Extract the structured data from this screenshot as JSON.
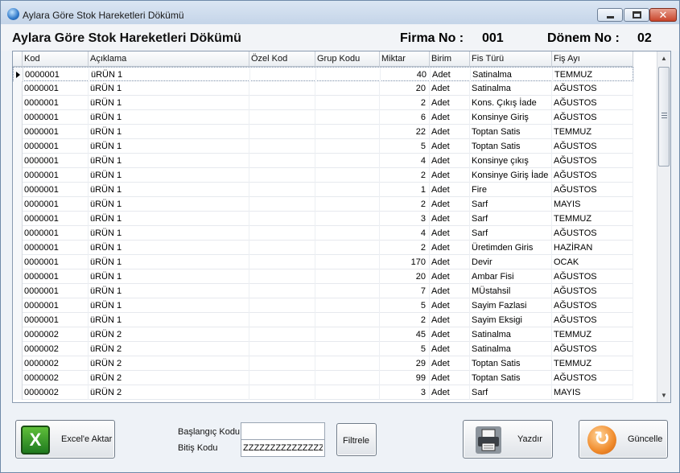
{
  "window": {
    "title": "Aylara Göre Stok Hareketleri Dökümü"
  },
  "header": {
    "title": "Aylara Göre Stok Hareketleri Dökümü",
    "firma_label": "Firma No :",
    "firma_value": "001",
    "donem_label": "Dönem No :",
    "donem_value": "02"
  },
  "grid": {
    "columns": [
      "Kod",
      "Açıklama",
      "Özel Kod",
      "Grup Kodu",
      "Miktar",
      "Birim",
      "Fis Türü",
      "Fiş Ayı"
    ],
    "rows": [
      [
        "0000001",
        "üRÜN 1",
        "",
        "",
        "40",
        "Adet",
        "Satinalma",
        "TEMMUZ"
      ],
      [
        "0000001",
        "üRÜN 1",
        "",
        "",
        "20",
        "Adet",
        "Satinalma",
        "AĞUSTOS"
      ],
      [
        "0000001",
        "üRÜN 1",
        "",
        "",
        "2",
        "Adet",
        "Kons. Çıkış İade",
        "AĞUSTOS"
      ],
      [
        "0000001",
        "üRÜN 1",
        "",
        "",
        "6",
        "Adet",
        "Konsinye Giriş",
        "AĞUSTOS"
      ],
      [
        "0000001",
        "üRÜN 1",
        "",
        "",
        "22",
        "Adet",
        "Toptan Satis",
        "TEMMUZ"
      ],
      [
        "0000001",
        "üRÜN 1",
        "",
        "",
        "5",
        "Adet",
        "Toptan Satis",
        "AĞUSTOS"
      ],
      [
        "0000001",
        "üRÜN 1",
        "",
        "",
        "4",
        "Adet",
        "Konsinye çıkış",
        "AĞUSTOS"
      ],
      [
        "0000001",
        "üRÜN 1",
        "",
        "",
        "2",
        "Adet",
        "Konsinye Giriş İade",
        "AĞUSTOS"
      ],
      [
        "0000001",
        "üRÜN 1",
        "",
        "",
        "1",
        "Adet",
        "Fire",
        "AĞUSTOS"
      ],
      [
        "0000001",
        "üRÜN 1",
        "",
        "",
        "2",
        "Adet",
        "Sarf",
        "MAYIS"
      ],
      [
        "0000001",
        "üRÜN 1",
        "",
        "",
        "3",
        "Adet",
        "Sarf",
        "TEMMUZ"
      ],
      [
        "0000001",
        "üRÜN 1",
        "",
        "",
        "4",
        "Adet",
        "Sarf",
        "AĞUSTOS"
      ],
      [
        "0000001",
        "üRÜN 1",
        "",
        "",
        "2",
        "Adet",
        "Üretimden Giris",
        "HAZİRAN"
      ],
      [
        "0000001",
        "üRÜN 1",
        "",
        "",
        "170",
        "Adet",
        "Devir",
        "OCAK"
      ],
      [
        "0000001",
        "üRÜN 1",
        "",
        "",
        "20",
        "Adet",
        "Ambar Fisi",
        "AĞUSTOS"
      ],
      [
        "0000001",
        "üRÜN 1",
        "",
        "",
        "7",
        "Adet",
        "MÜstahsil",
        "AĞUSTOS"
      ],
      [
        "0000001",
        "üRÜN 1",
        "",
        "",
        "5",
        "Adet",
        "Sayim Fazlasi",
        "AĞUSTOS"
      ],
      [
        "0000001",
        "üRÜN 1",
        "",
        "",
        "2",
        "Adet",
        "Sayim Eksigi",
        "AĞUSTOS"
      ],
      [
        "0000002",
        "üRÜN 2",
        "",
        "",
        "45",
        "Adet",
        "Satinalma",
        "TEMMUZ"
      ],
      [
        "0000002",
        "üRÜN 2",
        "",
        "",
        "5",
        "Adet",
        "Satinalma",
        "AĞUSTOS"
      ],
      [
        "0000002",
        "üRÜN 2",
        "",
        "",
        "29",
        "Adet",
        "Toptan Satis",
        "TEMMUZ"
      ],
      [
        "0000002",
        "üRÜN 2",
        "",
        "",
        "99",
        "Adet",
        "Toptan Satis",
        "AĞUSTOS"
      ],
      [
        "0000002",
        "üRÜN 2",
        "",
        "",
        "3",
        "Adet",
        "Sarf",
        "MAYIS"
      ]
    ]
  },
  "bottom": {
    "excel_label": "Excel'e Aktar",
    "start_code_label": "Başlangıç Kodu",
    "start_code_value": "",
    "end_code_label": "Bitiş Kodu",
    "end_code_value": "ZZZZZZZZZZZZZZZZ",
    "filter_label": "Filtrele",
    "print_label": "Yazdır",
    "refresh_label": "Güncelle"
  },
  "icons": {
    "app": "globe-icon",
    "excel": "excel-icon",
    "print": "printer-icon",
    "refresh": "refresh-icon"
  }
}
